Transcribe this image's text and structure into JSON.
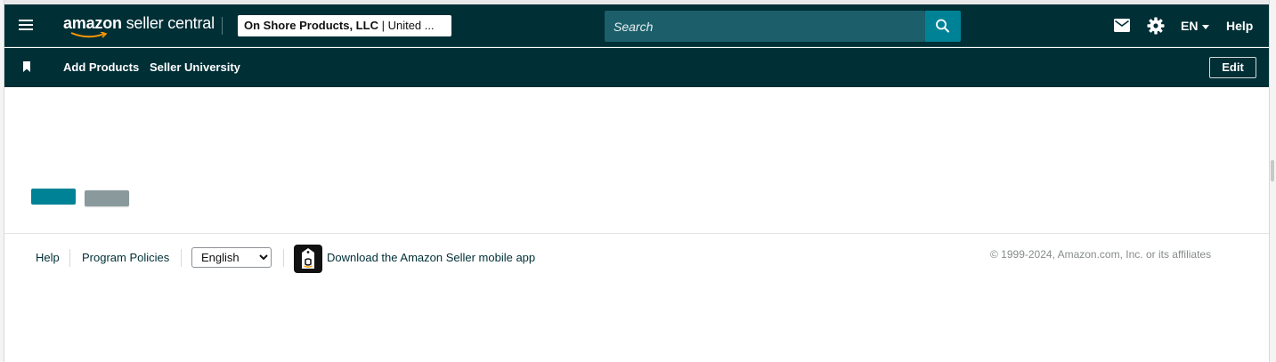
{
  "header": {
    "logo_bold": "amazon",
    "logo_rest": " seller central",
    "account_name": "On Shore Products, LLC",
    "account_region": " | United ...",
    "search_placeholder": "Search",
    "language": "EN",
    "help": "Help"
  },
  "subnav": {
    "items": [
      {
        "label": "Add Products"
      },
      {
        "label": "Seller University"
      }
    ],
    "edit_label": "Edit"
  },
  "footer": {
    "help": "Help",
    "program_policies": "Program Policies",
    "language_selected": "English",
    "app_link": "Download the Amazon Seller mobile app",
    "copyright": "© 1999-2024, Amazon.com, Inc. or its affiliates"
  },
  "colors": {
    "nav_bg": "#002f36",
    "search_bg": "#1c5f6b",
    "accent": "#008296",
    "secondary_button": "#8a9a9c"
  },
  "icons": [
    "menu-icon",
    "amazon-smile-icon",
    "search-icon",
    "mail-icon",
    "gear-icon",
    "chevron-down-icon",
    "bookmark-icon",
    "amazon-app-icon"
  ]
}
